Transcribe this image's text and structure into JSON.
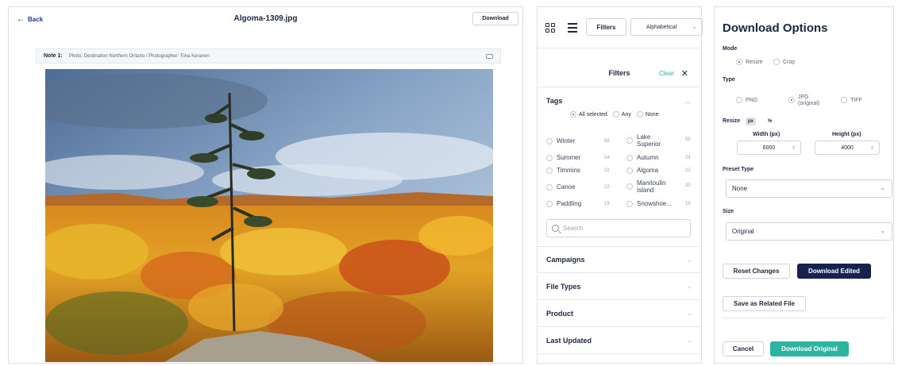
{
  "viewer": {
    "back_label": "Back",
    "file_title": "Algoma-1309.jpg",
    "download_label": "Download",
    "note_label": "Note 1:",
    "note_text": "Photo: Destination Northern Ontario / Photographer: Tiina Keranen"
  },
  "filters": {
    "filters_btn": "Filters",
    "sort_value": "Alphabetical",
    "panel_title": "Filters",
    "clear_label": "Clear",
    "close_glyph": "✕",
    "tags_title": "Tags",
    "tag_modes": [
      "All selected",
      "Any",
      "None"
    ],
    "tag_items": [
      {
        "name": "Winter",
        "count": "58"
      },
      {
        "name": "Lake Superior",
        "count": "55"
      },
      {
        "name": "Summer",
        "count": "54"
      },
      {
        "name": "Autumn",
        "count": "24"
      },
      {
        "name": "Timmins",
        "count": "22"
      },
      {
        "name": "Algoma",
        "count": "22"
      },
      {
        "name": "Canoe",
        "count": "22"
      },
      {
        "name": "Manitoulin Island",
        "count": "20"
      },
      {
        "name": "Paddling",
        "count": "19"
      },
      {
        "name": "Snowshoe...",
        "count": "19"
      }
    ],
    "search_placeholder": "Search",
    "sections": [
      "Campaigns",
      "File Types",
      "Product",
      "Last Updated"
    ]
  },
  "download_options": {
    "title": "Download Options",
    "mode_label": "Mode",
    "mode_options": [
      "Resize",
      "Crop"
    ],
    "type_label": "Type",
    "type_png": "PNG",
    "type_jpg": "JPG",
    "type_jpg_sub": "(original)",
    "type_tiff": "TIFF",
    "resize_label": "Resize",
    "unit_px": "px",
    "unit_pct": "%",
    "width_label": "Width (px)",
    "height_label": "Height (px)",
    "width_value": "6000",
    "height_value": "4000",
    "preset_label": "Preset Type",
    "preset_value": "None",
    "size_label": "Size",
    "size_value": "Original",
    "reset_label": "Reset Changes",
    "download_edited_label": "Download Edited",
    "save_related_label": "Save as Related File",
    "cancel_label": "Cancel",
    "download_original_label": "Download Original"
  },
  "colors": {
    "accent_teal": "#2bb5a0",
    "navy": "#15224f"
  }
}
